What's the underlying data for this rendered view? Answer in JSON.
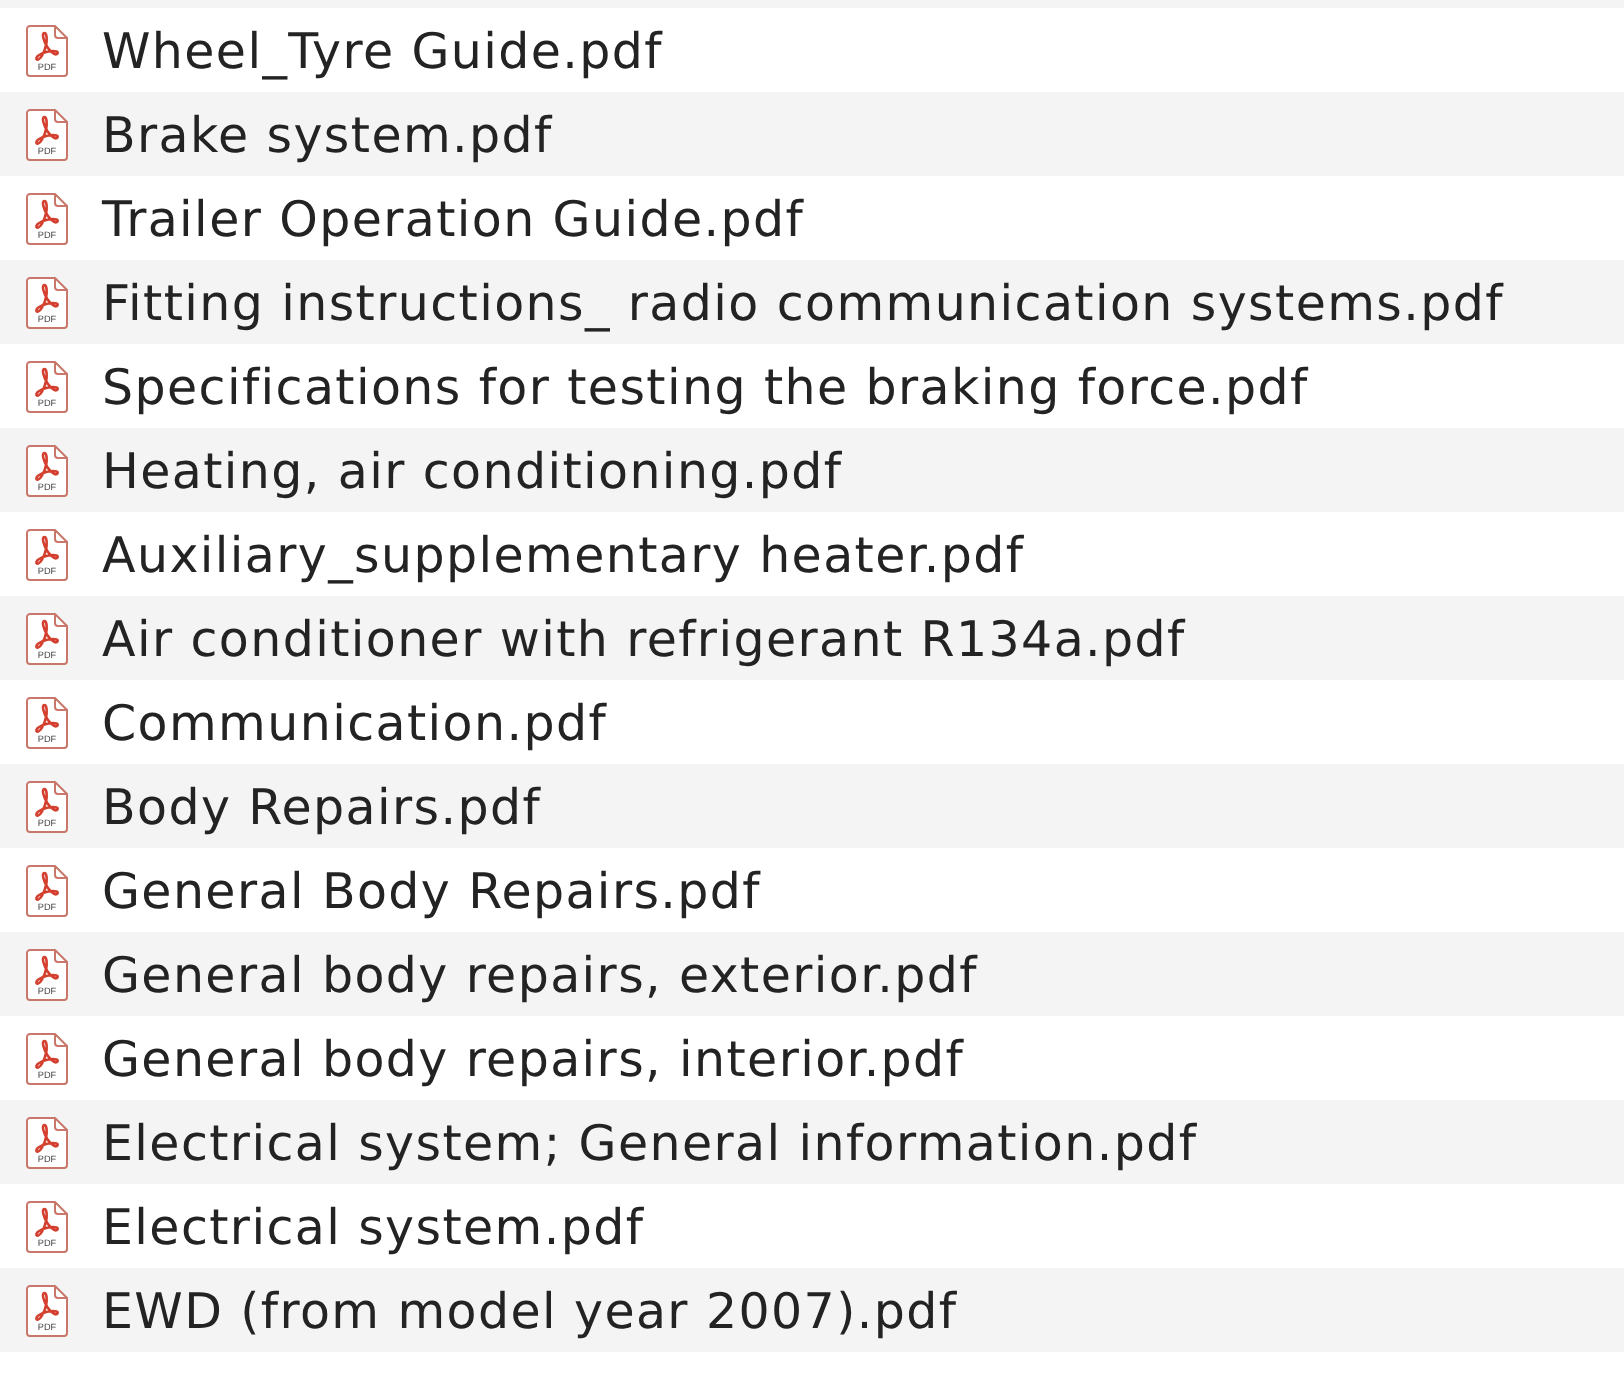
{
  "files": [
    {
      "name": "Wheel_Tyre Guide.pdf",
      "icon_label": "PDF"
    },
    {
      "name": "Brake system.pdf",
      "icon_label": "PDF"
    },
    {
      "name": "Trailer Operation Guide.pdf",
      "icon_label": "PDF"
    },
    {
      "name": "Fitting instructions_ radio communication systems.pdf",
      "icon_label": "PDF"
    },
    {
      "name": "Specifications for testing the braking force.pdf",
      "icon_label": "PDF"
    },
    {
      "name": "Heating, air conditioning.pdf",
      "icon_label": "PDF"
    },
    {
      "name": "Auxiliary_supplementary heater.pdf",
      "icon_label": "PDF"
    },
    {
      "name": "Air conditioner with refrigerant R134a.pdf",
      "icon_label": "PDF"
    },
    {
      "name": "Communication.pdf",
      "icon_label": "PDF"
    },
    {
      "name": "Body Repairs.pdf",
      "icon_label": "PDF"
    },
    {
      "name": "General Body Repairs.pdf",
      "icon_label": "PDF"
    },
    {
      "name": "General body repairs, exterior.pdf",
      "icon_label": "PDF"
    },
    {
      "name": "General body repairs, interior.pdf",
      "icon_label": "PDF"
    },
    {
      "name": "Electrical system; General information.pdf",
      "icon_label": "PDF"
    },
    {
      "name": "Electrical system.pdf",
      "icon_label": "PDF"
    },
    {
      "name": "EWD (from model year 2007).pdf",
      "icon_label": "PDF"
    }
  ]
}
